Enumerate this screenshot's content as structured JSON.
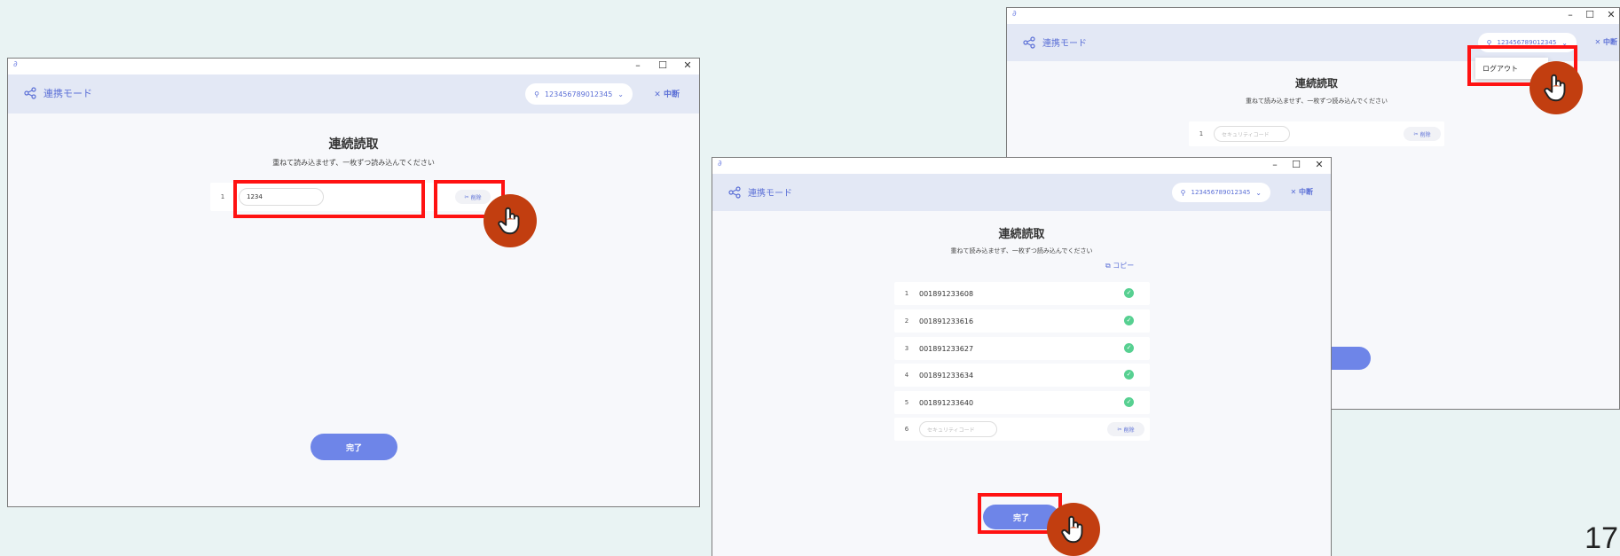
{
  "common": {
    "mode_label": "連携モード",
    "user_id": "123456789012345",
    "stop_label": "中断",
    "title": "連続読取",
    "subtitle": "重ねて読み込ませず、一枚ずつ読み込んでください",
    "clear_label": "削除",
    "done_label": "完了",
    "placeholder": "セキュリティコード",
    "win_min": "–",
    "win_max": "☐",
    "win_close": "✕"
  },
  "win1": {
    "rows": [
      {
        "num": "1",
        "value": "1234"
      }
    ]
  },
  "win3": {
    "rows": [
      {
        "num": "1"
      }
    ],
    "logout_label": "ログアウト"
  },
  "win2": {
    "copy_label": "コピー",
    "rows": [
      {
        "num": "1",
        "value": "001891233608"
      },
      {
        "num": "2",
        "value": "001891233616"
      },
      {
        "num": "3",
        "value": "001891233627"
      },
      {
        "num": "4",
        "value": "001891233634"
      },
      {
        "num": "5",
        "value": "001891233640"
      },
      {
        "num": "6"
      }
    ]
  },
  "page_number": "17",
  "colors": {
    "accent": "#6e85e8",
    "highlight": "#ff1212",
    "hand": "#c23e10",
    "success": "#57d091"
  }
}
